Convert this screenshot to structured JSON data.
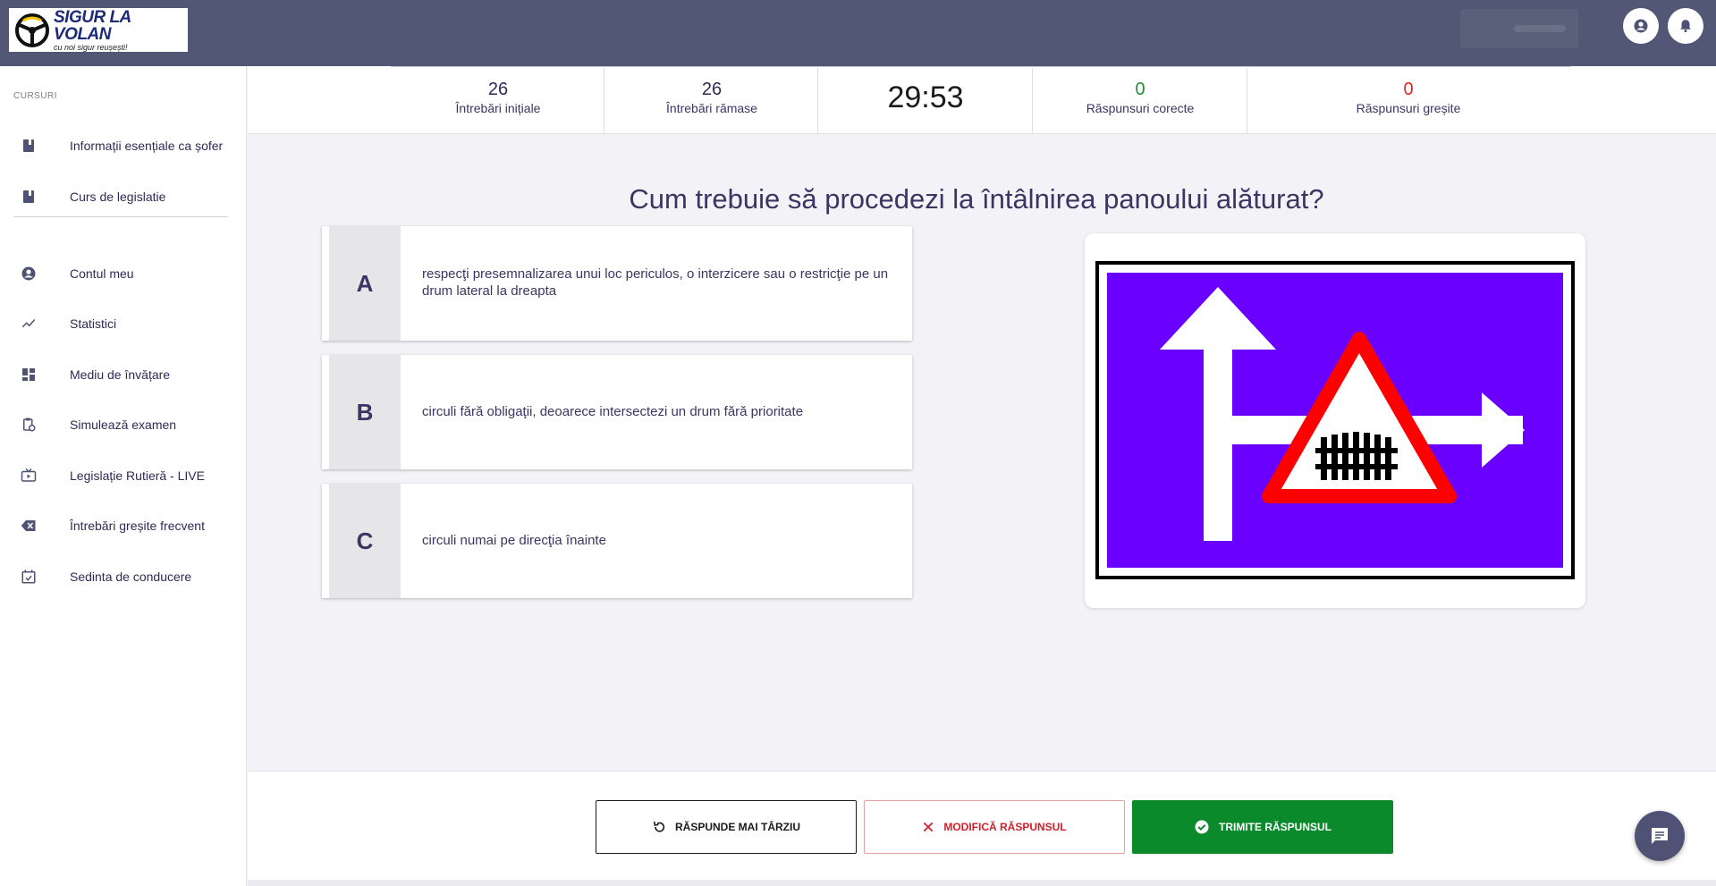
{
  "brand": {
    "title": "SIGUR LA VOLAN",
    "subtitle": "cu noi sigur reușești!"
  },
  "colors": {
    "topbar": "#515774",
    "accent_text": "#3b3564",
    "correct": "#1f8f34",
    "wrong": "#e02525",
    "submit": "#0b8a2c",
    "sign_background": "#6a00ff",
    "sign_border": "#ff0000"
  },
  "sidebar": {
    "section_label": "CURSURI",
    "courses": [
      {
        "label": "Informații esențiale ca șofer",
        "icon": "book-icon"
      },
      {
        "label": "Curs de legislatie",
        "icon": "book-icon"
      }
    ],
    "items": [
      {
        "label": "Contul meu",
        "icon": "account-circle-icon"
      },
      {
        "label": "Statistici",
        "icon": "trending-up-icon"
      },
      {
        "label": "Mediu de învățare",
        "icon": "dashboard-icon"
      },
      {
        "label": "Simulează examen",
        "icon": "clipboard-clock-icon"
      },
      {
        "label": "Legislație Rutieră - LIVE",
        "icon": "live-tv-icon"
      },
      {
        "label": "Întrebări greșite frecvent",
        "icon": "backspace-x-icon"
      },
      {
        "label": "Sedinta de conducere",
        "icon": "calendar-check-icon"
      }
    ]
  },
  "stats": {
    "initial": {
      "value": "26",
      "label": "Întrebări inițiale"
    },
    "remaining": {
      "value": "26",
      "label": "Întrebări rămase"
    },
    "timer": "29:53",
    "correct": {
      "value": "0",
      "label": "Răspunsuri corecte"
    },
    "wrong": {
      "value": "0",
      "label": "Răspunsuri greșite"
    }
  },
  "question": {
    "text": "Cum trebuie să procedezi la întâlnirea panoului alăturat?",
    "answers": [
      {
        "letter": "A",
        "text": "respecţi presemnalizarea unui loc periculos, o interzicere sau o restricţie pe un drum lateral la dreapta"
      },
      {
        "letter": "B",
        "text": "circuli fără obligaţii, deoarece intersectezi un drum fără prioritate"
      },
      {
        "letter": "C",
        "text": "circuli numai pe direcţia înainte"
      }
    ],
    "image": "road-sign-railway-crossing-right-side-road"
  },
  "actions": {
    "later": "RĂSPUNDE MAI TÂRZIU",
    "modify": "MODIFICĂ RĂSPUNSUL",
    "submit": "TRIMITE RĂSPUNSUL"
  }
}
